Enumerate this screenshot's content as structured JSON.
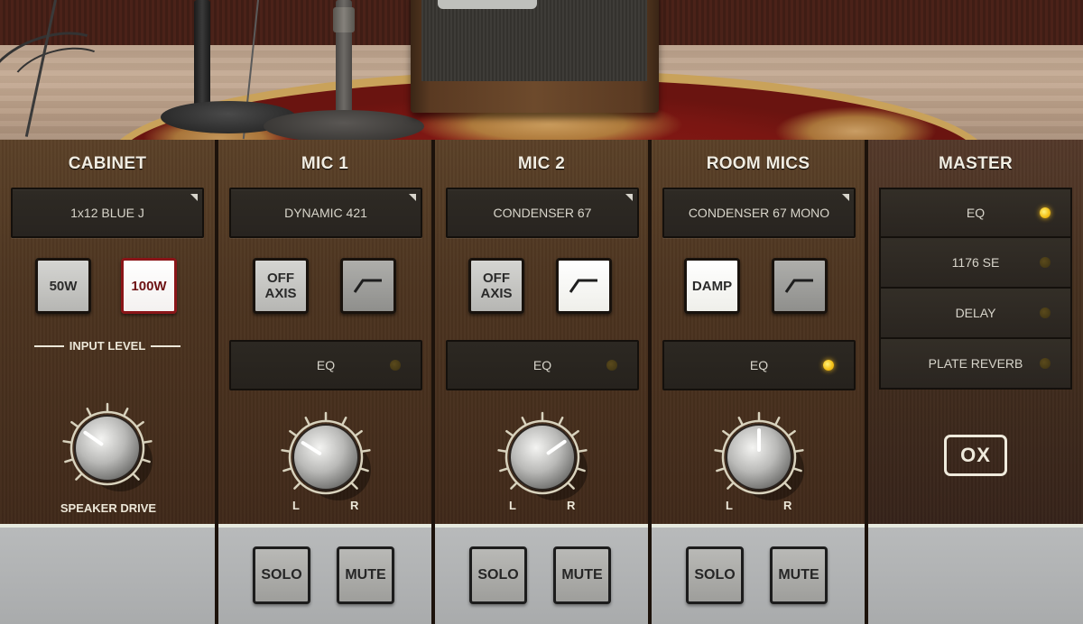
{
  "scene": {
    "description": "studio room with amp cabinet, mic stands, rug"
  },
  "cabinet": {
    "title": "CABINET",
    "selector_value": "1x12 BLUE J",
    "buttons": [
      {
        "label": "50W",
        "active": false
      },
      {
        "label": "100W",
        "active": true
      }
    ],
    "input_level_label": "INPUT LEVEL",
    "knob_label": "SPEAKER DRIVE",
    "knob_value_deg": -55
  },
  "mic1": {
    "title": "MIC 1",
    "selector_value": "DYNAMIC 421",
    "off_axis_label": "OFF\nAXIS",
    "off_axis_active": false,
    "hpf_icon": "high-pass-filter-icon",
    "hpf_active": false,
    "eq_label": "EQ",
    "eq_on": false,
    "pan_left": "L",
    "pan_right": "R",
    "pan_deg": -58,
    "solo_label": "SOLO",
    "mute_label": "MUTE"
  },
  "mic2": {
    "title": "MIC 2",
    "selector_value": "CONDENSER 67",
    "off_axis_label": "OFF\nAXIS",
    "off_axis_active": false,
    "hpf_icon": "high-pass-filter-icon",
    "hpf_active": true,
    "eq_label": "EQ",
    "eq_on": false,
    "pan_left": "L",
    "pan_right": "R",
    "pan_deg": 55,
    "solo_label": "SOLO",
    "mute_label": "MUTE"
  },
  "room_mics": {
    "title": "ROOM MICS",
    "selector_value": "CONDENSER 67 MONO",
    "damp_label": "DAMP",
    "damp_active": true,
    "hpf_icon": "high-pass-filter-icon",
    "hpf_active": false,
    "eq_label": "EQ",
    "eq_on": true,
    "pan_left": "L",
    "pan_right": "R",
    "pan_deg": 0,
    "solo_label": "SOLO",
    "mute_label": "MUTE"
  },
  "master": {
    "title": "MASTER",
    "effects": [
      {
        "label": "EQ",
        "on": true
      },
      {
        "label": "1176 SE",
        "on": false
      },
      {
        "label": "DELAY",
        "on": false
      },
      {
        "label": "PLATE REVERB",
        "on": false
      }
    ],
    "ox_label": "OX"
  },
  "colors": {
    "led_on": "#f4c21a",
    "led_off": "#4a3c16",
    "panel_brown": "#4c3420",
    "text_cream": "#f1ede2",
    "active_red_border": "#8a1518"
  }
}
